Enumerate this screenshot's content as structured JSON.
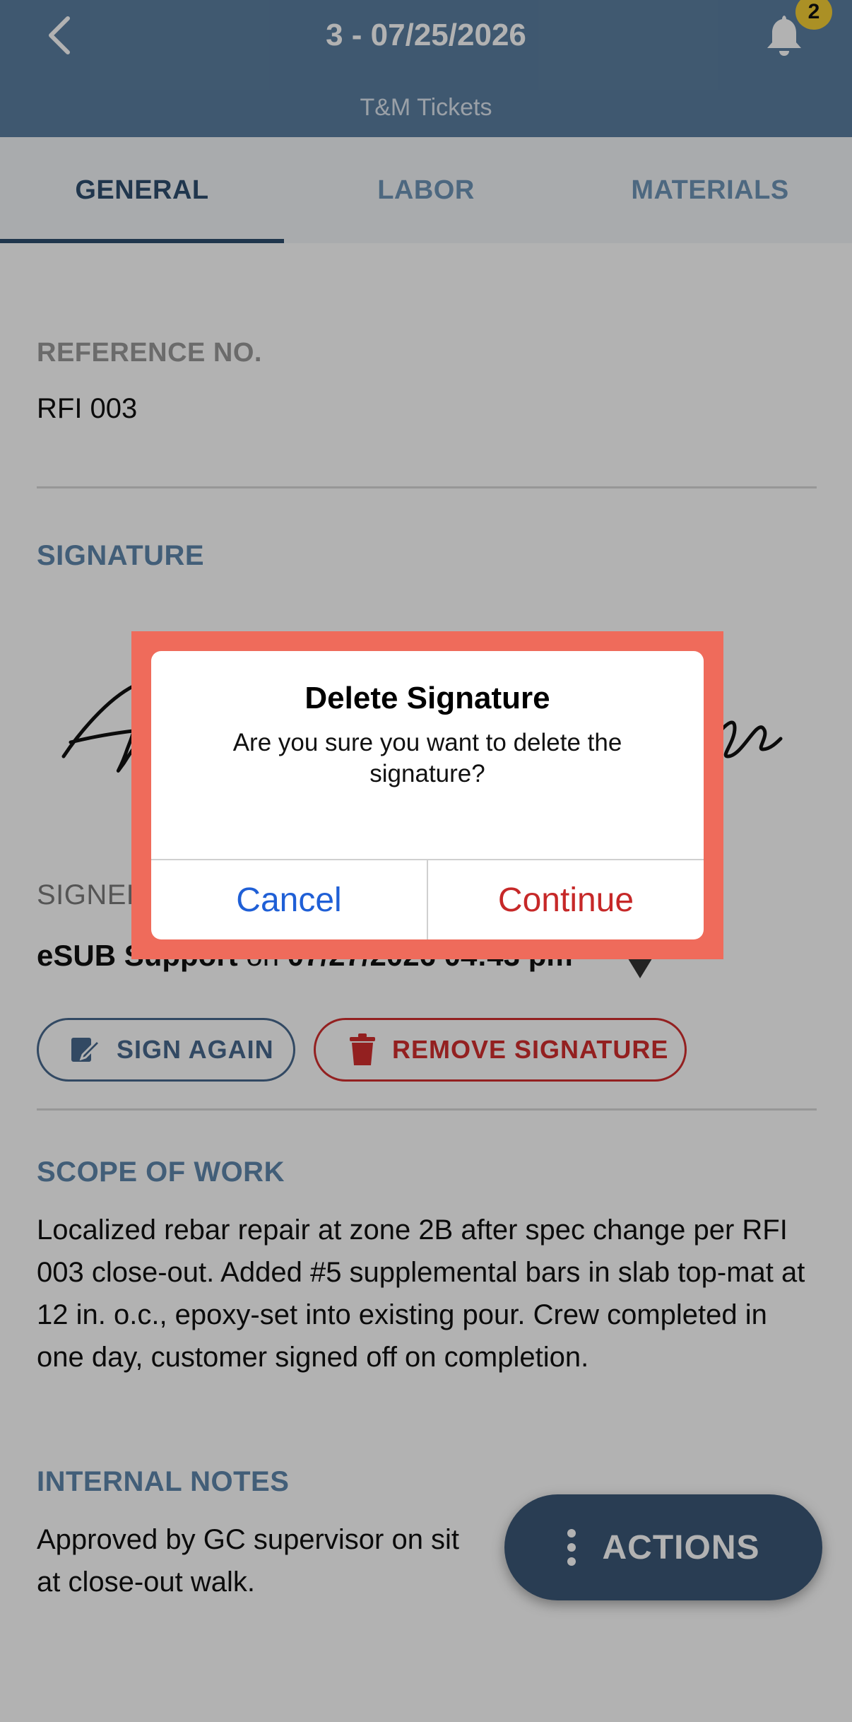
{
  "header": {
    "title": "3 - 07/25/2026",
    "subtitle": "T&M Tickets",
    "notification_count": "2"
  },
  "tabs": [
    {
      "label": "GENERAL",
      "active": true
    },
    {
      "label": "LABOR",
      "active": false
    },
    {
      "label": "MATERIALS",
      "active": false
    }
  ],
  "reference": {
    "label": "REFERENCE NO.",
    "value": "RFI 003"
  },
  "signature": {
    "title": "SIGNATURE",
    "signed_label": "SIGNED",
    "signer": "eSUB Support",
    "on_text": "on",
    "date": "07/27/2026 04:43 pm",
    "sign_again_label": "SIGN AGAIN",
    "remove_label": "REMOVE SIGNATURE"
  },
  "scope": {
    "title": "SCOPE OF WORK",
    "text": "Localized rebar repair at zone 2B after spec change per RFI 003 close-out. Added #5 supplemental bars in slab top-mat at 12 in. o.c., epoxy-set into existing pour. Crew completed in one day, customer signed off on completion."
  },
  "notes": {
    "title": "INTERNAL NOTES",
    "text_line1": "Approved by GC supervisor on sit",
    "text_line2": "at close-out walk."
  },
  "actions": {
    "label": "ACTIONS"
  },
  "dialog": {
    "title": "Delete Signature",
    "message": "Are you sure you want to delete the signature?",
    "cancel_label": "Cancel",
    "continue_label": "Continue"
  },
  "colors": {
    "header_bg": "#5b7fa1",
    "accent": "#2e4e6f",
    "danger": "#d32f2f",
    "highlight": "#ef6b5b",
    "badge": "#f5cf36"
  }
}
